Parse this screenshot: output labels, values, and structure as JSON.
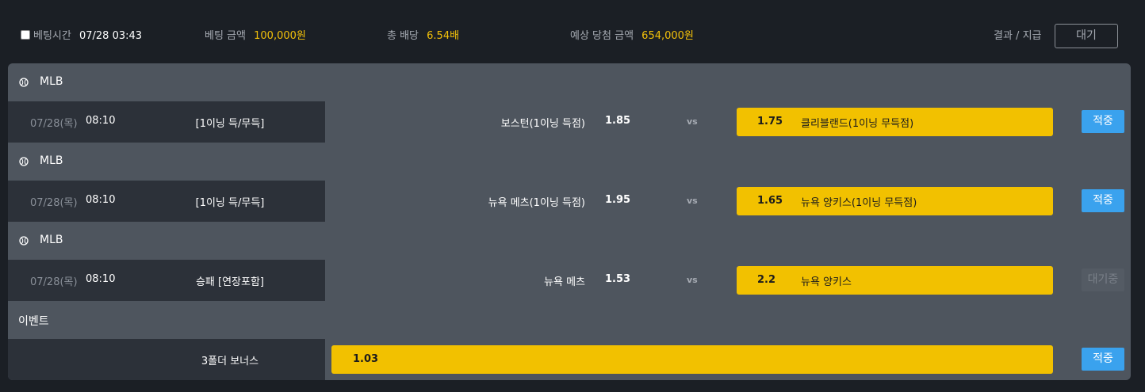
{
  "topbar": {
    "bet_time_label": "베팅시간",
    "bet_time_value": "07/28 03:43",
    "bet_amount_label": "베팅 금액",
    "bet_amount_value": "100,000원",
    "total_odds_label": "총 배당",
    "total_odds_value": "6.54배",
    "expected_win_label": "예상 당첨 금액",
    "expected_win_value": "654,000원",
    "result_label": "결과 / 지급",
    "wait_button": "대기"
  },
  "leagues": [
    {
      "name": "MLB",
      "date": "07/28(목)",
      "time": "08:10",
      "market": "[1이닝 득/무득]",
      "home": "보스턴(1이닝 득점)",
      "home_odds": "1.85",
      "vs": "vs",
      "away_odds": "1.75",
      "away": "클리블랜드(1이닝 무득점)",
      "status": "적중"
    },
    {
      "name": "MLB",
      "date": "07/28(목)",
      "time": "08:10",
      "market": "[1이닝 득/무득]",
      "home": "뉴욕 메츠(1이닝 득점)",
      "home_odds": "1.95",
      "vs": "vs",
      "away_odds": "1.65",
      "away": "뉴욕 양키스(1이닝 무득점)",
      "status": "적중"
    },
    {
      "name": "MLB",
      "date": "07/28(목)",
      "time": "08:10",
      "market": "승패 [연장포함]",
      "home": "뉴욕 메츠",
      "home_odds": "1.53",
      "vs": "vs",
      "away_odds": "2.2",
      "away": "뉴욕 양키스",
      "status": "대기중"
    }
  ],
  "event": {
    "header": "이벤트",
    "name": "3폴더 보너스",
    "odds": "1.03",
    "status": "적중"
  },
  "colors": {
    "background": "#1b1f25",
    "panel": "#4e555e",
    "cell_dark": "#2c3139",
    "accent_gold": "#f3c10a",
    "hit_blue": "#3aa2ee"
  }
}
